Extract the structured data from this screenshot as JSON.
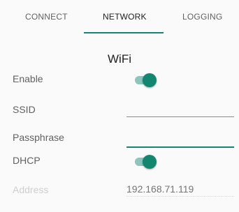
{
  "colors": {
    "accent": "#138672",
    "accent_light": "#8cc5bb"
  },
  "tabs": [
    {
      "label": "CONNECT",
      "active": false
    },
    {
      "label": "NETWORK",
      "active": true
    },
    {
      "label": "LOGGING",
      "active": false
    }
  ],
  "section_title": "WiFi",
  "form": {
    "enable": {
      "label": "Enable",
      "checked": true
    },
    "ssid": {
      "label": "SSID",
      "value": "",
      "placeholder": ""
    },
    "passphrase": {
      "label": "Passphrase",
      "value": "",
      "placeholder": ""
    },
    "dhcp": {
      "label": "DHCP",
      "checked": true
    },
    "address": {
      "label": "Address",
      "value": "",
      "placeholder": "192.168.71.119",
      "disabled": true
    }
  }
}
